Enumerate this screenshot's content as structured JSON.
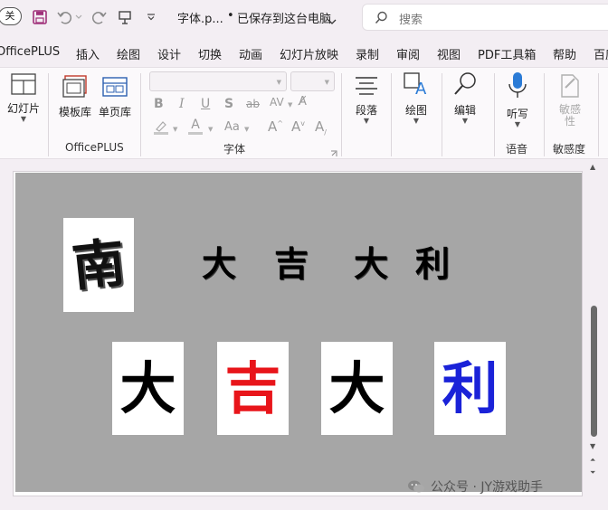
{
  "titlebar": {
    "autosave_toggle": "关",
    "doc_name": "字体.p...",
    "separator": "•",
    "save_status": "已保存到这台电脑",
    "search_placeholder": "搜索"
  },
  "tabs": [
    {
      "label": "OfficePLUS"
    },
    {
      "label": "插入"
    },
    {
      "label": "绘图"
    },
    {
      "label": "设计"
    },
    {
      "label": "切换"
    },
    {
      "label": "动画"
    },
    {
      "label": "幻灯片放映"
    },
    {
      "label": "录制"
    },
    {
      "label": "审阅"
    },
    {
      "label": "视图"
    },
    {
      "label": "PDF工具箱"
    },
    {
      "label": "帮助"
    },
    {
      "label": "百度"
    }
  ],
  "ribbon": {
    "slide_btn": "幻灯片",
    "template_btn": "模板库",
    "single_page_btn": "单页库",
    "officeplus_group": "OfficePLUS",
    "font_group": "字体",
    "font_size_a": "A",
    "font_aa": "Aa",
    "paragraph_btn": "段落",
    "drawing_btn": "绘图",
    "editing_btn": "编辑",
    "dictate_btn": "听写",
    "voice_group": "语音",
    "sensitivity_btn_1": "敏感",
    "sensitivity_btn_2": "性",
    "sensitivity_group": "敏感度"
  },
  "slide": {
    "title_chars": [
      "大",
      "吉",
      "大",
      "利"
    ],
    "logo_char": "南",
    "cards": [
      {
        "char": "大",
        "color": "#000000"
      },
      {
        "char": "吉",
        "color": "#e8151a"
      },
      {
        "char": "大",
        "color": "#000000"
      },
      {
        "char": "利",
        "color": "#1a22d8"
      }
    ]
  },
  "watermark": {
    "text": "公众号 · JY游戏助手"
  }
}
